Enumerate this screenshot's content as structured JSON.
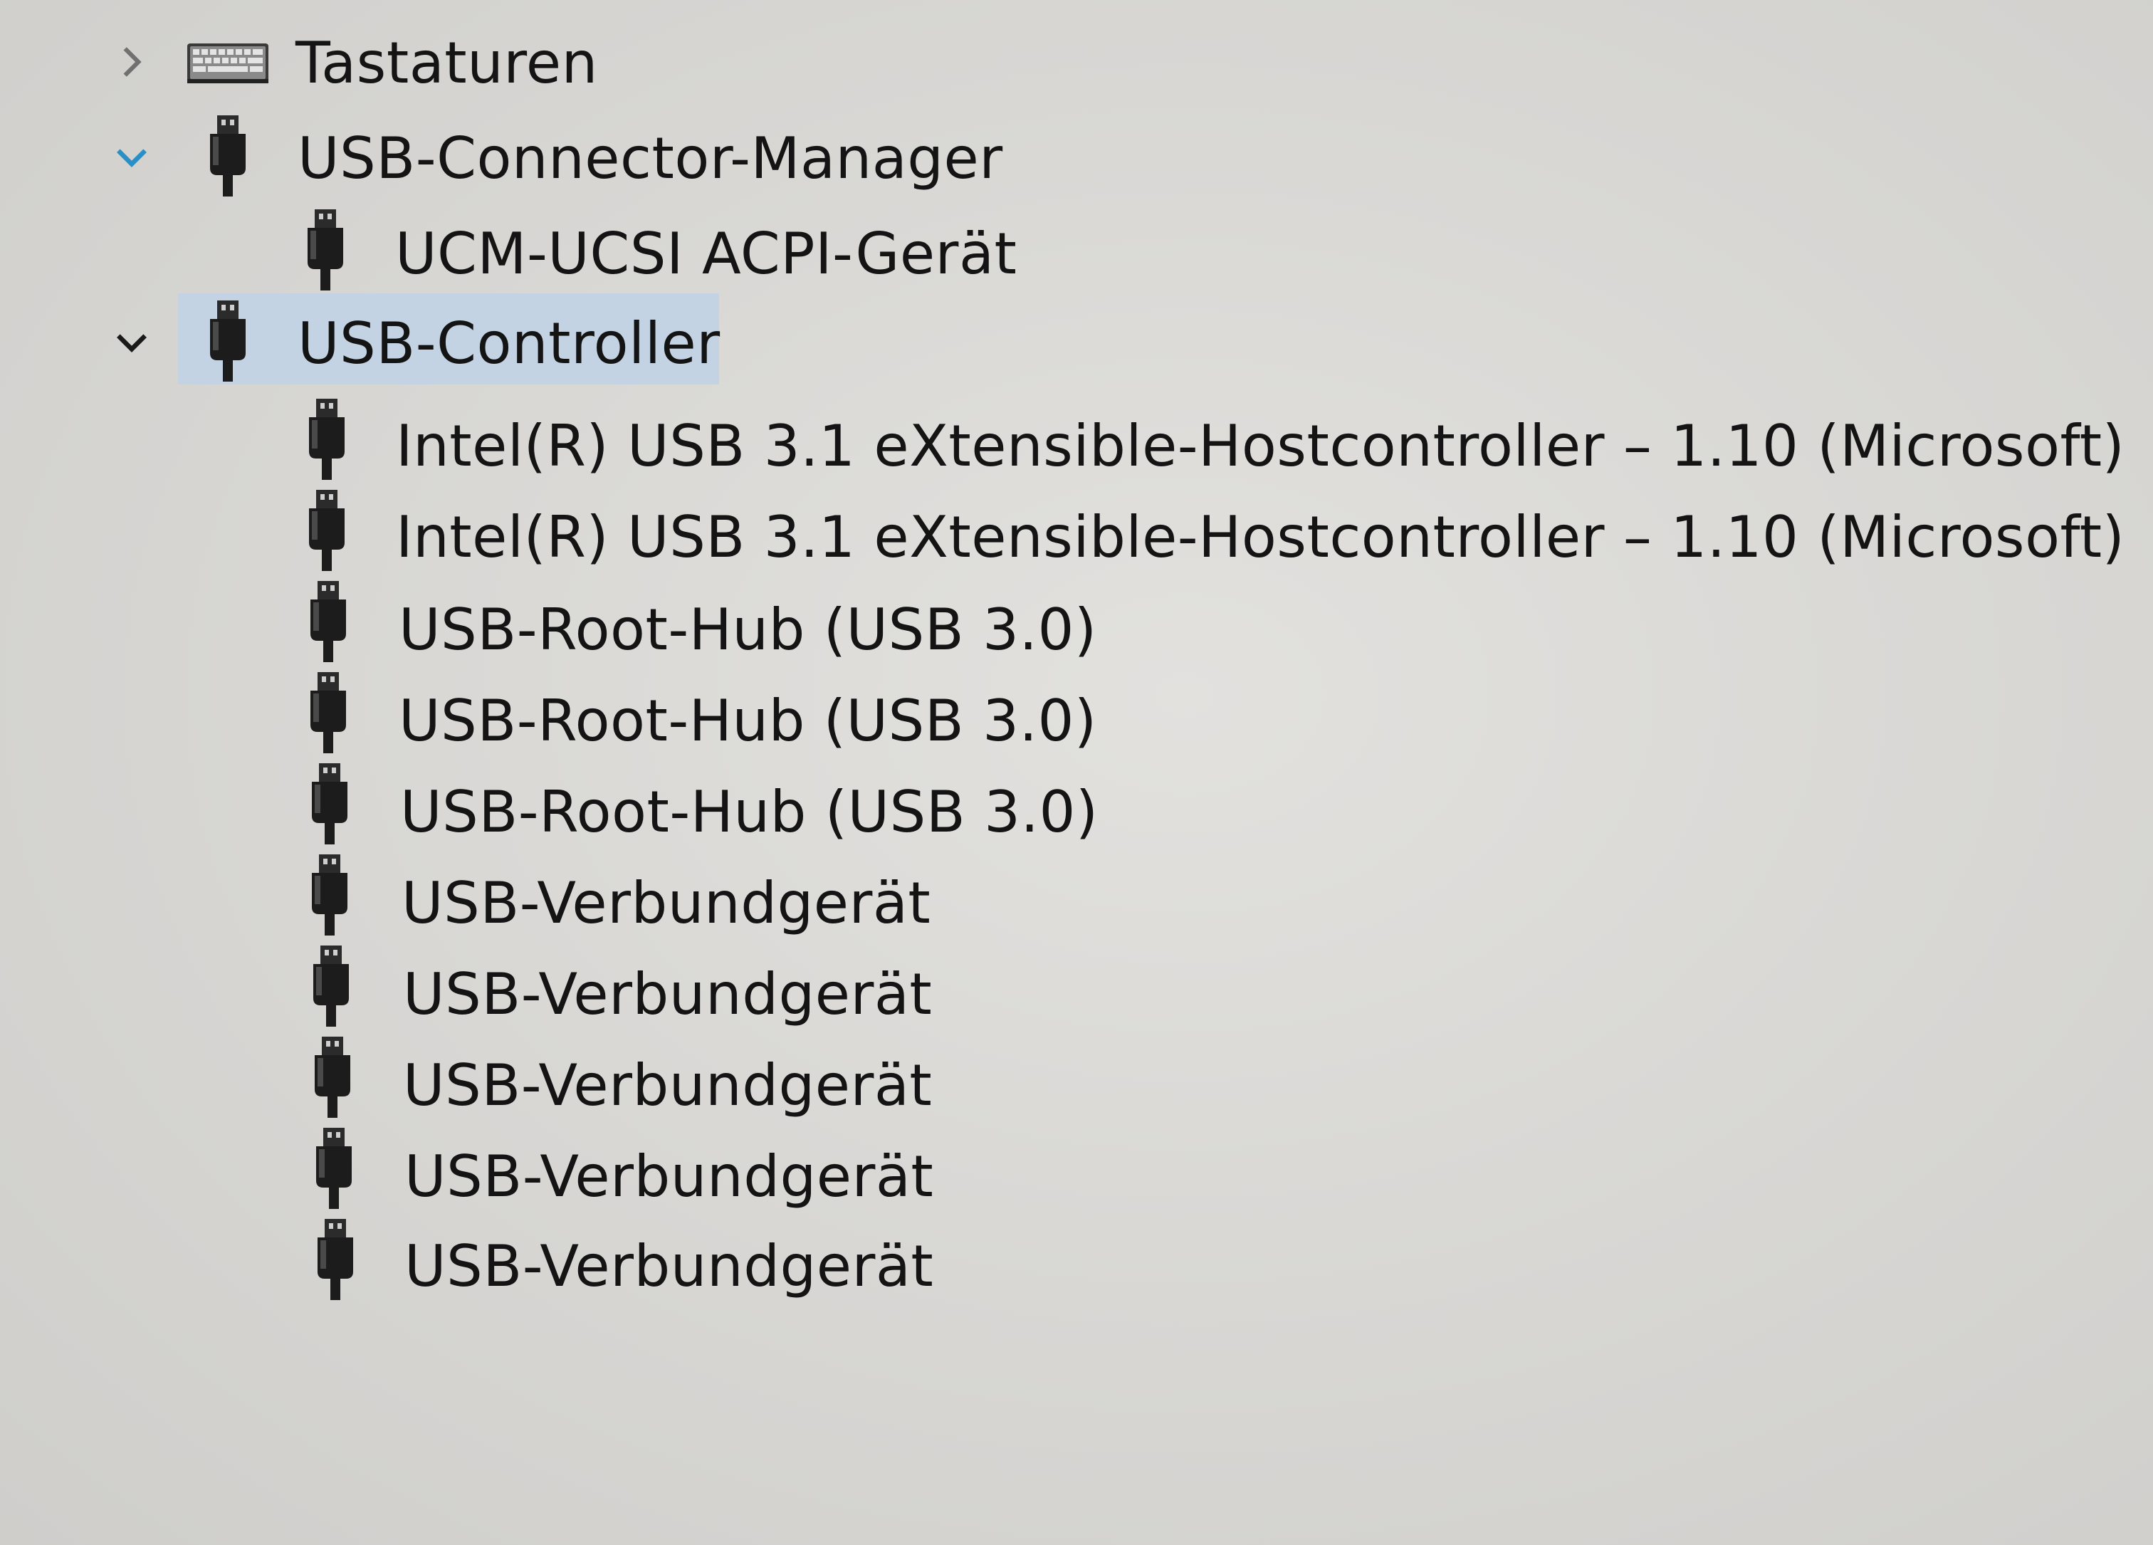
{
  "tree": {
    "categories": [
      {
        "label": "Tastaturen",
        "icon": "keyboard-icon",
        "expanded": false,
        "selected": false,
        "children": []
      },
      {
        "label": "USB-Connector-Manager",
        "icon": "usb-plug-icon",
        "expanded": true,
        "selected": false,
        "children": [
          {
            "label": "UCM-UCSI ACPI-Gerät",
            "icon": "usb-plug-icon"
          }
        ]
      },
      {
        "label": "USB-Controller",
        "icon": "usb-plug-icon",
        "expanded": true,
        "selected": true,
        "children": [
          {
            "label": "Intel(R) USB 3.1 eXtensible-Hostcontroller – 1.10 (Microsoft)",
            "icon": "usb-plug-icon"
          },
          {
            "label": "Intel(R) USB 3.1 eXtensible-Hostcontroller – 1.10 (Microsoft)",
            "icon": "usb-plug-icon"
          },
          {
            "label": "USB-Root-Hub (USB 3.0)",
            "icon": "usb-plug-icon"
          },
          {
            "label": "USB-Root-Hub (USB 3.0)",
            "icon": "usb-plug-icon"
          },
          {
            "label": "USB-Root-Hub (USB 3.0)",
            "icon": "usb-plug-icon"
          },
          {
            "label": "USB-Verbundgerät",
            "icon": "usb-plug-icon"
          },
          {
            "label": "USB-Verbundgerät",
            "icon": "usb-plug-icon"
          },
          {
            "label": "USB-Verbundgerät",
            "icon": "usb-plug-icon"
          },
          {
            "label": "USB-Verbundgerät",
            "icon": "usb-plug-icon"
          },
          {
            "label": "USB-Verbundgerät",
            "icon": "usb-plug-icon"
          }
        ]
      }
    ]
  },
  "colors": {
    "chevron_collapsed": "#707070",
    "chevron_expanded_hover": "#2a8fc7",
    "chevron_expanded": "#1a1a1a",
    "selection": "#c3d3e4",
    "text": "#141414"
  }
}
